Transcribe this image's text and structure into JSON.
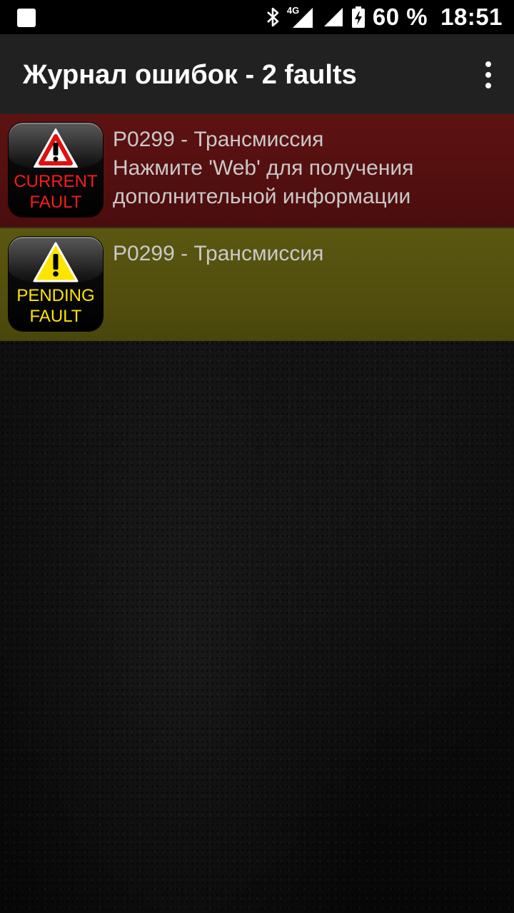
{
  "status_bar": {
    "network_type": "4G",
    "battery_percent": "60 %",
    "time": "18:51",
    "icons": [
      "notification-square-icon",
      "bluetooth-icon",
      "signal-4g-icon",
      "signal-icon",
      "battery-charging-icon"
    ]
  },
  "toolbar": {
    "title": "Журнал ошибок - 2 faults",
    "menu_icon": "overflow-menu-icon"
  },
  "faults": [
    {
      "badge_line1": "CURRENT",
      "badge_line2": "FAULT",
      "code_title": "P0299 - Трансмиссия",
      "desc_line1": "Нажмите 'Web' для получения",
      "desc_line2": "дополнительной информации",
      "color": "#5e1212",
      "badge_text_color": "#ff1a1a"
    },
    {
      "badge_line1": "PENDING",
      "badge_line2": "FAULT",
      "code_title": "P0299 - Трансмиссия",
      "color": "#5a5711",
      "badge_text_color": "#ffe400"
    }
  ]
}
